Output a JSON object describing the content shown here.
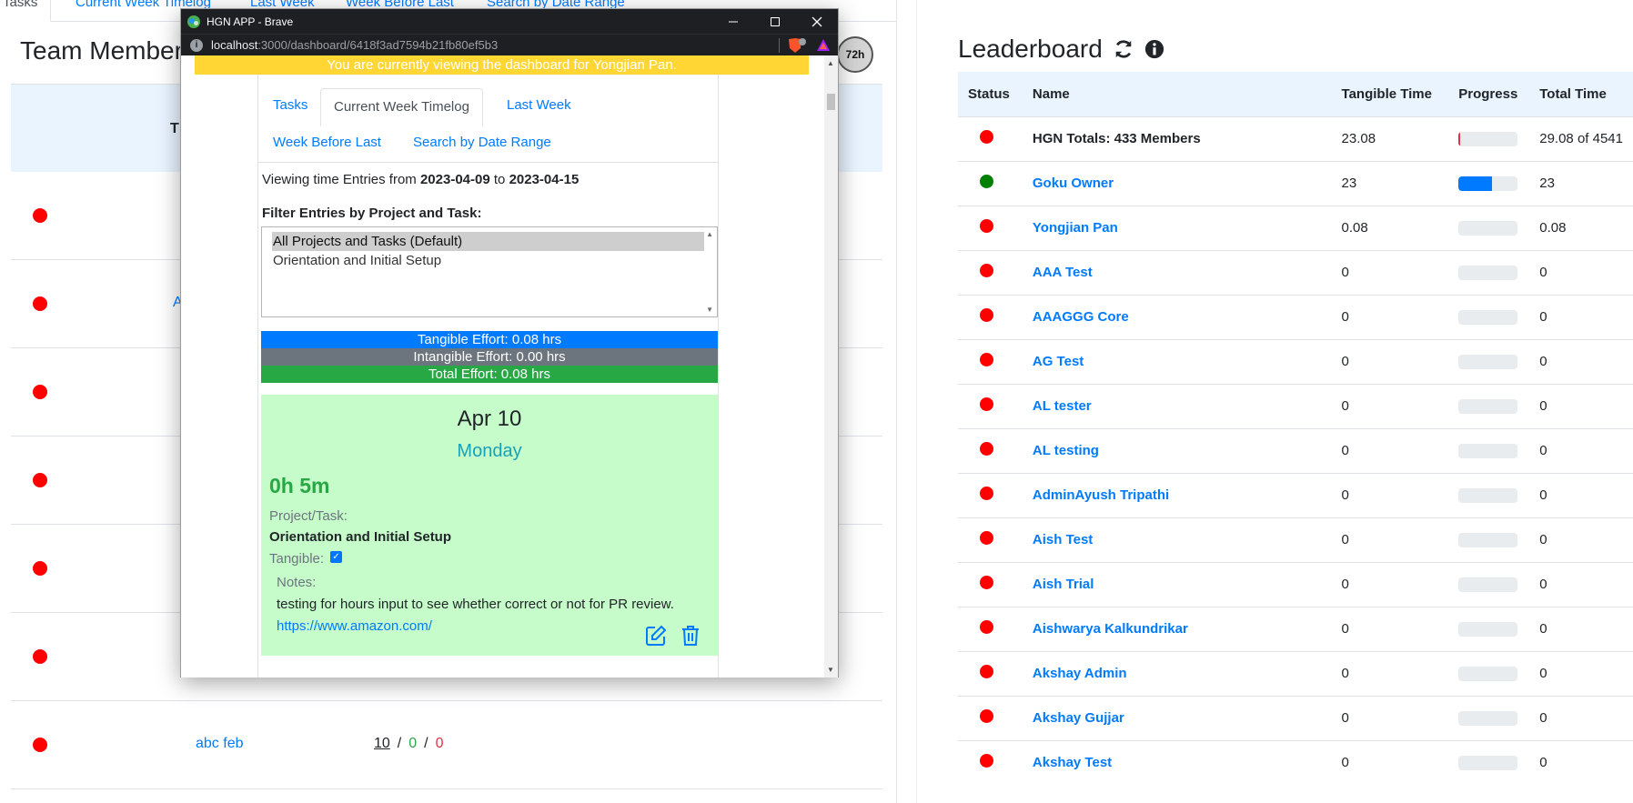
{
  "background": {
    "tabs": [
      "Tasks",
      "Current Week Timelog",
      "Last Week",
      "Week Before Last",
      "Search by Date Range"
    ],
    "title": "Team Member",
    "header_cut": "T",
    "rows": [
      {
        "cut": ""
      },
      {
        "cut": "A"
      },
      {
        "cut": ""
      },
      {
        "cut": ""
      },
      {
        "cut": ""
      },
      {
        "cut": ""
      },
      {
        "name": "abc feb",
        "hours": {
          "a": "10",
          "sep1": "/",
          "b": "0",
          "sep2": "/",
          "c": "0"
        }
      }
    ]
  },
  "avatar_badge": "72h",
  "popup": {
    "window_title": "HGN APP - Brave",
    "url_host": "localhost",
    "url_path": ":3000/dashboard/6418f3ad7594b21fb80ef5b3",
    "banner": "You are currently viewing the dashboard for Yongjian Pan.",
    "tabs": [
      "Tasks",
      "Current Week Timelog",
      "Last Week",
      "Week Before Last",
      "Search by Date Range"
    ],
    "viewing_prefix": "Viewing time Entries from",
    "date_from": "2023-04-09",
    "viewing_mid": "to",
    "date_to": "2023-04-15",
    "filter_label": "Filter Entries by Project and Task:",
    "filter_options": [
      "All Projects and Tasks (Default)",
      "Orientation and Initial Setup"
    ],
    "tangible": "Tangible Effort: 0.08 hrs",
    "intangible": "Intangible Effort: 0.00 hrs",
    "total": "Total Effort: 0.08 hrs",
    "entry": {
      "date": "Apr 10",
      "day": "Monday",
      "duration": "0h 5m",
      "project_label": "Project/Task:",
      "project": "Orientation and Initial Setup",
      "tangible_label": "Tangible:",
      "notes_label": "Notes:",
      "notes": "testing for hours input to see whether correct or not for PR review.",
      "link": "https://www.amazon.com/"
    }
  },
  "leaderboard": {
    "title": "Leaderboard",
    "columns": [
      "Status",
      "Name",
      "Tangible Time",
      "Progress",
      "Total Time"
    ],
    "rows": [
      {
        "status": "red",
        "name": "HGN Totals: 433 Members",
        "tangible": "23.08",
        "progress": 0.03,
        "bar": "#dc3545",
        "total": "29.08 of 4541",
        "link": false
      },
      {
        "status": "green",
        "name": "Goku Owner",
        "tangible": "23",
        "progress": 0.57,
        "bar": "#007bff",
        "total": "23",
        "link": true
      },
      {
        "status": "red",
        "name": "Yongjian Pan",
        "tangible": "0.08",
        "progress": 0,
        "bar": "#dc3545",
        "total": "0.08",
        "link": true
      },
      {
        "status": "red",
        "name": "AAA Test",
        "tangible": "0",
        "progress": 0,
        "bar": "#dc3545",
        "total": "0",
        "link": true
      },
      {
        "status": "red",
        "name": "AAAGGG Core",
        "tangible": "0",
        "progress": 0,
        "bar": "#dc3545",
        "total": "0",
        "link": true
      },
      {
        "status": "red",
        "name": "AG Test",
        "tangible": "0",
        "progress": 0,
        "bar": "#dc3545",
        "total": "0",
        "link": true
      },
      {
        "status": "red",
        "name": "AL tester",
        "tangible": "0",
        "progress": 0,
        "bar": "#dc3545",
        "total": "0",
        "link": true
      },
      {
        "status": "red",
        "name": "AL testing",
        "tangible": "0",
        "progress": 0,
        "bar": "#dc3545",
        "total": "0",
        "link": true
      },
      {
        "status": "red",
        "name": "AdminAyush Tripathi",
        "tangible": "0",
        "progress": 0,
        "bar": "#dc3545",
        "total": "0",
        "link": true
      },
      {
        "status": "red",
        "name": "Aish Test",
        "tangible": "0",
        "progress": 0,
        "bar": "#dc3545",
        "total": "0",
        "link": true
      },
      {
        "status": "red",
        "name": "Aish Trial",
        "tangible": "0",
        "progress": 0,
        "bar": "#dc3545",
        "total": "0",
        "link": true
      },
      {
        "status": "red",
        "name": "Aishwarya Kalkundrikar",
        "tangible": "0",
        "progress": 0,
        "bar": "#dc3545",
        "total": "0",
        "link": true
      },
      {
        "status": "red",
        "name": "Akshay Admin",
        "tangible": "0",
        "progress": 0,
        "bar": "#dc3545",
        "total": "0",
        "link": true
      },
      {
        "status": "red",
        "name": "Akshay Gujjar",
        "tangible": "0",
        "progress": 0,
        "bar": "#dc3545",
        "total": "0",
        "link": true
      },
      {
        "status": "red",
        "name": "Akshay Test",
        "tangible": "0",
        "progress": 0,
        "bar": "#dc3545",
        "total": "0",
        "link": true
      }
    ]
  }
}
